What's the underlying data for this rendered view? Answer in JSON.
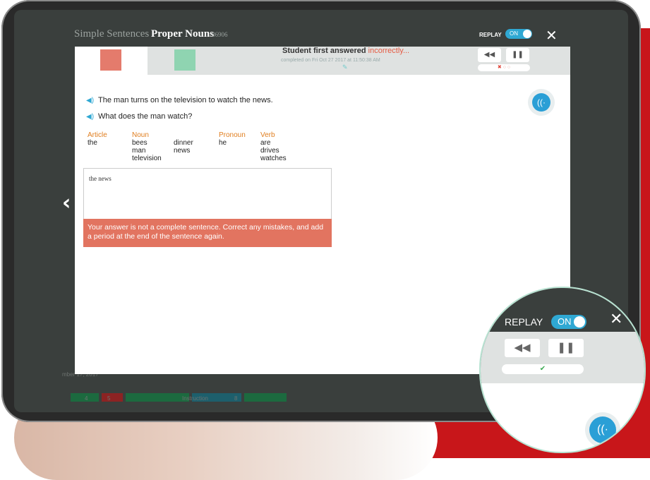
{
  "header": {
    "breadcrumb": "Simple Sentences",
    "title": "Proper Nouns",
    "id": "86906",
    "replay_label": "REPLAY",
    "toggle_label": "ON",
    "close_icon": "close-icon"
  },
  "status": {
    "title": "Student first answered ",
    "title_status": "incorrectly...",
    "subtitle": "completed on Fri Oct 27 2017 at 11:50:38 AM",
    "rewind_icon": "rewind-icon",
    "pause_icon": "pause-icon",
    "progress": [
      "✖",
      "○",
      "○"
    ]
  },
  "prompt": {
    "sentence": "The man turns on the television to watch the news.",
    "question": "What does the man watch?"
  },
  "word_bank": [
    {
      "header": "Article",
      "words": [
        "the"
      ]
    },
    {
      "header": "Noun",
      "words": [
        "bees",
        "man",
        "television"
      ]
    },
    {
      "header": "",
      "words": [
        "dinner",
        "news"
      ]
    },
    {
      "header": "Pronoun",
      "words": [
        "he"
      ]
    },
    {
      "header": "Verb",
      "words": [
        "are",
        "drives",
        "watches"
      ]
    }
  ],
  "answer": {
    "value": "the news",
    "error": "Your answer is not a complete sentence. Correct any mistakes, and add a period at the end of the sentence again."
  },
  "background": {
    "date": "mber 17, 2017",
    "cells": [
      "4",
      "5",
      "Instruction",
      "8"
    ]
  },
  "zoom": {
    "replay_label": "REPLAY",
    "toggle_label": "ON",
    "progress": "✔"
  },
  "colors": {
    "accent": "#2fa8d3",
    "error": "#e27460",
    "correct": "#8fd4b1",
    "incorrect": "#e47b6c",
    "backdrop_red": "#c8161a"
  }
}
